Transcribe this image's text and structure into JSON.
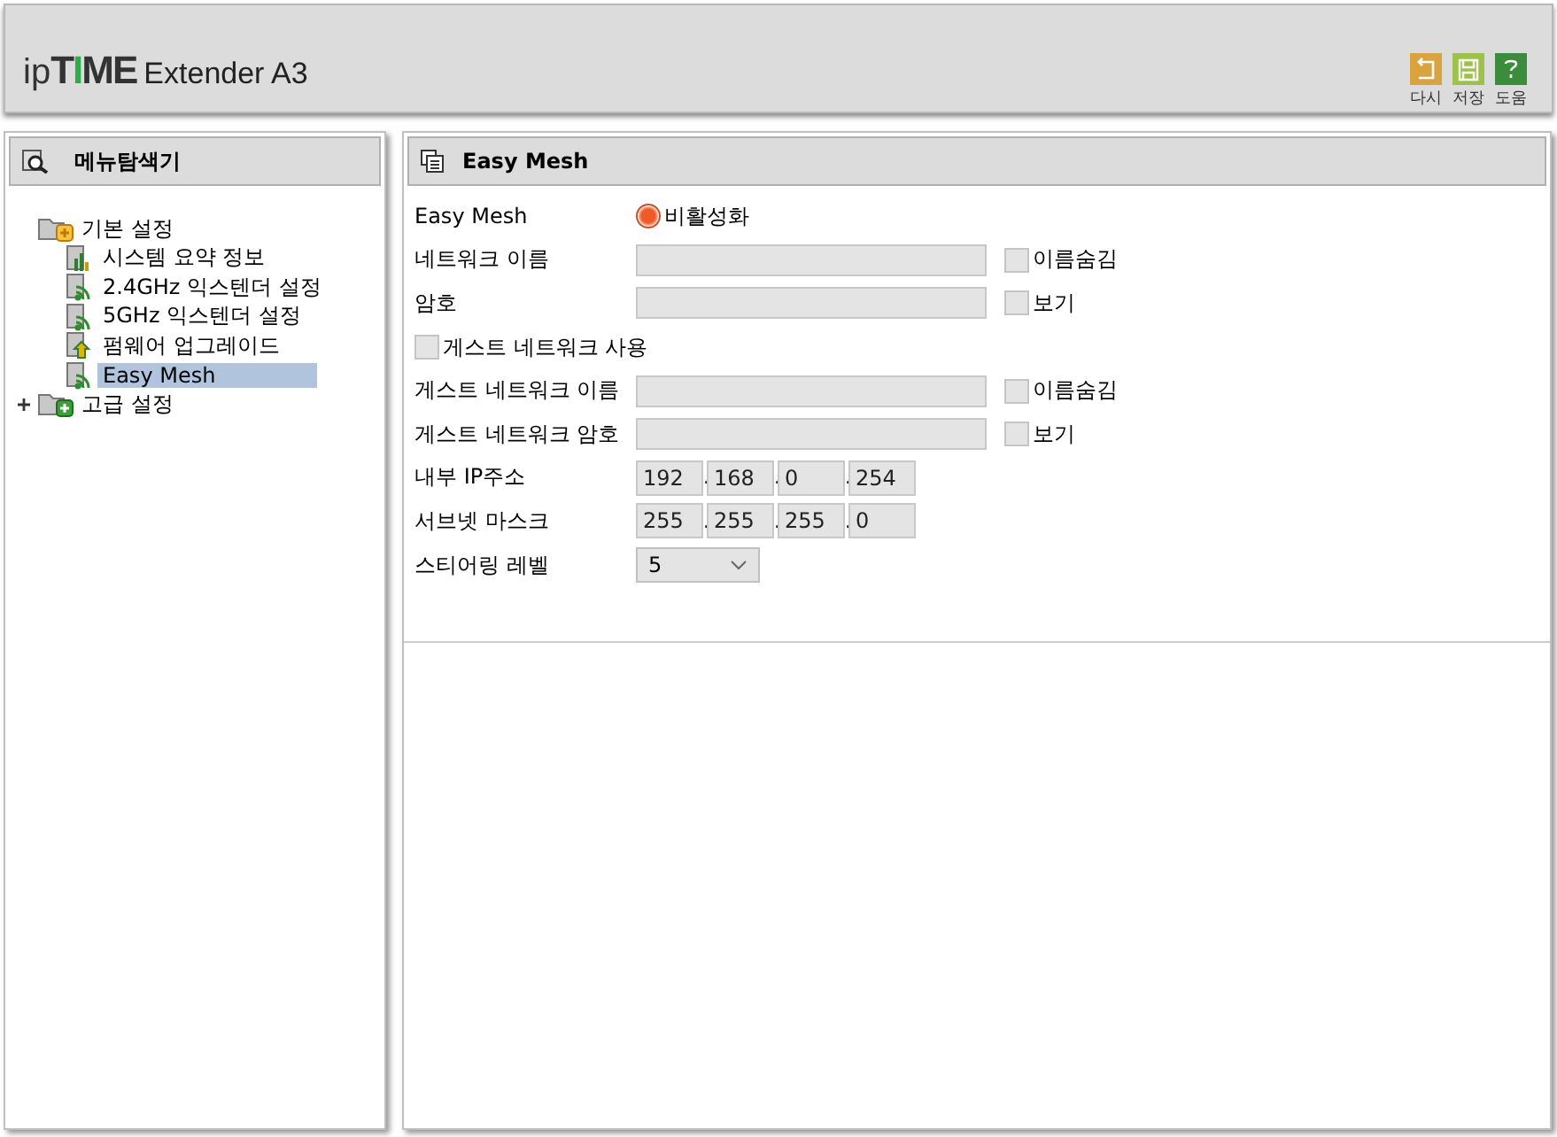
{
  "header": {
    "logo": {
      "prefix": "ip",
      "brand": [
        {
          "text": "T",
          "accent": false
        },
        {
          "text": "I",
          "accent": true
        },
        {
          "text": "M",
          "accent": false
        },
        {
          "text": "E",
          "accent": false
        }
      ]
    },
    "product": "Extender A3",
    "actions": [
      {
        "label": "다시",
        "kind": "undo",
        "color": "#d9a440"
      },
      {
        "label": "저장",
        "kind": "save",
        "color": "#9cc24a"
      },
      {
        "label": "도움",
        "kind": "help",
        "color": "#3b8c3b"
      }
    ]
  },
  "sidebar": {
    "title": "메뉴탐색기",
    "tree": [
      {
        "label": "기본 설정",
        "expanded": true,
        "children": [
          {
            "label": "시스템 요약 정보",
            "kind": "chart",
            "selected": false
          },
          {
            "label": "2.4GHz 익스텐더 설정",
            "kind": "wifi",
            "selected": false
          },
          {
            "label": "5GHz 익스텐더 설정",
            "kind": "wifi",
            "selected": false
          },
          {
            "label": "펌웨어 업그레이드",
            "kind": "upgrade",
            "selected": false
          },
          {
            "label": "Easy Mesh",
            "kind": "wifi",
            "selected": true
          }
        ]
      },
      {
        "label": "고급 설정",
        "expanded": false
      }
    ]
  },
  "content": {
    "title": "Easy Mesh",
    "rows": [
      {
        "kind": "radio",
        "label": "Easy Mesh",
        "option": "비활성화",
        "selected": true
      },
      {
        "kind": "text",
        "label": "네트워크 이름",
        "value": "",
        "disabled": true,
        "check": {
          "label": "이름숨김",
          "checked": false
        }
      },
      {
        "kind": "text",
        "label": "암호",
        "value": "",
        "disabled": true,
        "check": {
          "label": "보기",
          "checked": false
        }
      },
      {
        "kind": "checkbox",
        "label": "게스트 네트워크 사용",
        "checked": false
      },
      {
        "kind": "text",
        "label": "게스트 네트워크 이름",
        "value": "",
        "disabled": true,
        "check": {
          "label": "이름숨김",
          "checked": false
        }
      },
      {
        "kind": "text",
        "label": "게스트 네트워크 암호",
        "value": "",
        "disabled": true,
        "check": {
          "label": "보기",
          "checked": false
        }
      },
      {
        "kind": "ip",
        "label": "내부 IP주소",
        "octets": [
          "192",
          "168",
          "0",
          "254"
        ],
        "separator": "."
      },
      {
        "kind": "ip",
        "label": "서브넷 마스크",
        "octets": [
          "255",
          "255",
          "255",
          "0"
        ],
        "separator": "."
      },
      {
        "kind": "select",
        "label": "스티어링 레벨",
        "value": "5"
      }
    ]
  }
}
